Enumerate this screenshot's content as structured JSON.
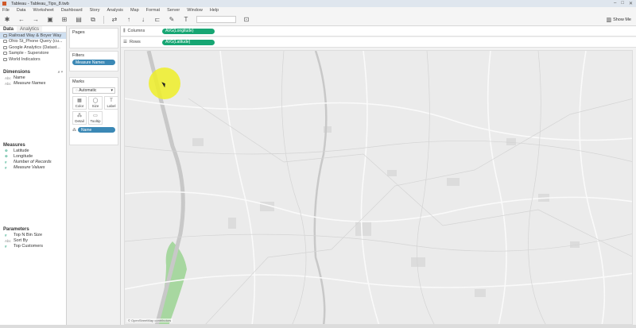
{
  "window": {
    "title": "Tableau - Tableau_Tips_8.twb",
    "controls": [
      "–",
      "□",
      "✕"
    ]
  },
  "menu": [
    "File",
    "Data",
    "Worksheet",
    "Dashboard",
    "Story",
    "Analysis",
    "Map",
    "Format",
    "Server",
    "Window",
    "Help"
  ],
  "toolbar": {
    "show_me_label": "Show Me"
  },
  "data_pane": {
    "tabs": [
      {
        "label": "Data"
      },
      {
        "label": "Analytics"
      }
    ],
    "sources": [
      {
        "label": "Railroad Way & Boyer Way",
        "selected": true
      },
      {
        "label": "Ohio St_Phone Query (cu...",
        "selected": false
      },
      {
        "label": "Google Analytics (Datast...",
        "selected": false
      },
      {
        "label": "Sample - Superstore",
        "selected": false
      },
      {
        "label": "World Indicators",
        "selected": false
      }
    ],
    "dimensions_title": "Dimensions",
    "dimensions": [
      {
        "type": "Abc",
        "label": "Name",
        "italic": false
      },
      {
        "type": "Abc",
        "label": "Measure Names",
        "italic": true
      }
    ],
    "measures_title": "Measures",
    "measures": [
      {
        "type": "⊕",
        "label": "Latitude",
        "italic": false
      },
      {
        "type": "⊕",
        "label": "Longitude",
        "italic": false
      },
      {
        "type": "#",
        "label": "Number of Records",
        "italic": true
      },
      {
        "type": "#",
        "label": "Measure Values",
        "italic": true
      }
    ],
    "parameters_title": "Parameters",
    "parameters": [
      {
        "type": "#",
        "label": "Top N Bin Size"
      },
      {
        "type": "Abc",
        "label": "Sort By"
      },
      {
        "type": "#",
        "label": "Top Customers"
      }
    ]
  },
  "shelves": {
    "pages_title": "Pages",
    "filters_title": "Filters",
    "filter_pill": "Measure Names",
    "marks_title": "Marks",
    "mark_type": "Automatic",
    "mark_buttons": [
      {
        "icon": "▦",
        "label": "Color"
      },
      {
        "icon": "◯",
        "label": "Size"
      },
      {
        "icon": "T",
        "label": "Label"
      },
      {
        "icon": "⁂",
        "label": "Detail"
      },
      {
        "icon": "▭",
        "label": "Tooltip"
      }
    ],
    "detail_pill": "Name",
    "columns_label": "Columns",
    "columns_pill": "AVG(Longitude)",
    "rows_label": "Rows",
    "rows_pill": "AVG(Latitude)"
  },
  "map": {
    "attribution": "© OpenStreetMap contributors"
  },
  "colors": {
    "dimension_pill": "#3b88b5",
    "measure_pill": "#17a673",
    "river": "#c8c8c8",
    "park": "#a7d7a0"
  }
}
